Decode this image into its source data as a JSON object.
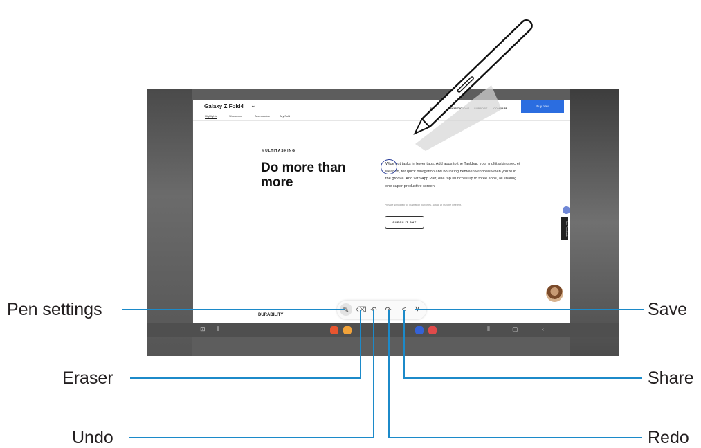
{
  "website": {
    "brand": "Galaxy Z Fold4",
    "nav_links": [
      "REVIEWS",
      "SPECIFICATIONS",
      "SUPPORT",
      "COMPARE"
    ],
    "buy_label": "Buy now",
    "sub_tabs": [
      "Highlights",
      "Showroom",
      "Accessories",
      "My Fold"
    ],
    "kicker": "MULTITASKING",
    "headline": "Do more than more",
    "body": "Wipe out tasks in fewer taps. Add apps to the Taskbar, your multitasking secret weapon, for quick navigation and bouncing between windows when you're in the groove. And with App Pair, one tap launches up to three apps, all sharing one super-productive screen.",
    "disclaimer": "*Image simulated for illustration purposes. Actual UI may be different.",
    "cta": "CHECK IT OUT",
    "footer_text": "DURABILITY",
    "feedback_tab": "See Feedback"
  },
  "toolbar": {
    "tools": [
      "pen-settings",
      "eraser",
      "undo",
      "redo",
      "share",
      "save"
    ]
  },
  "callouts": {
    "pen_settings": "Pen settings",
    "eraser": "Eraser",
    "undo": "Undo",
    "save": "Save",
    "share": "Share",
    "redo": "Redo"
  },
  "colors": {
    "callout_line": "#1c8ac9",
    "buy_button": "#2b6de0",
    "frame": "#5d5d5d"
  }
}
